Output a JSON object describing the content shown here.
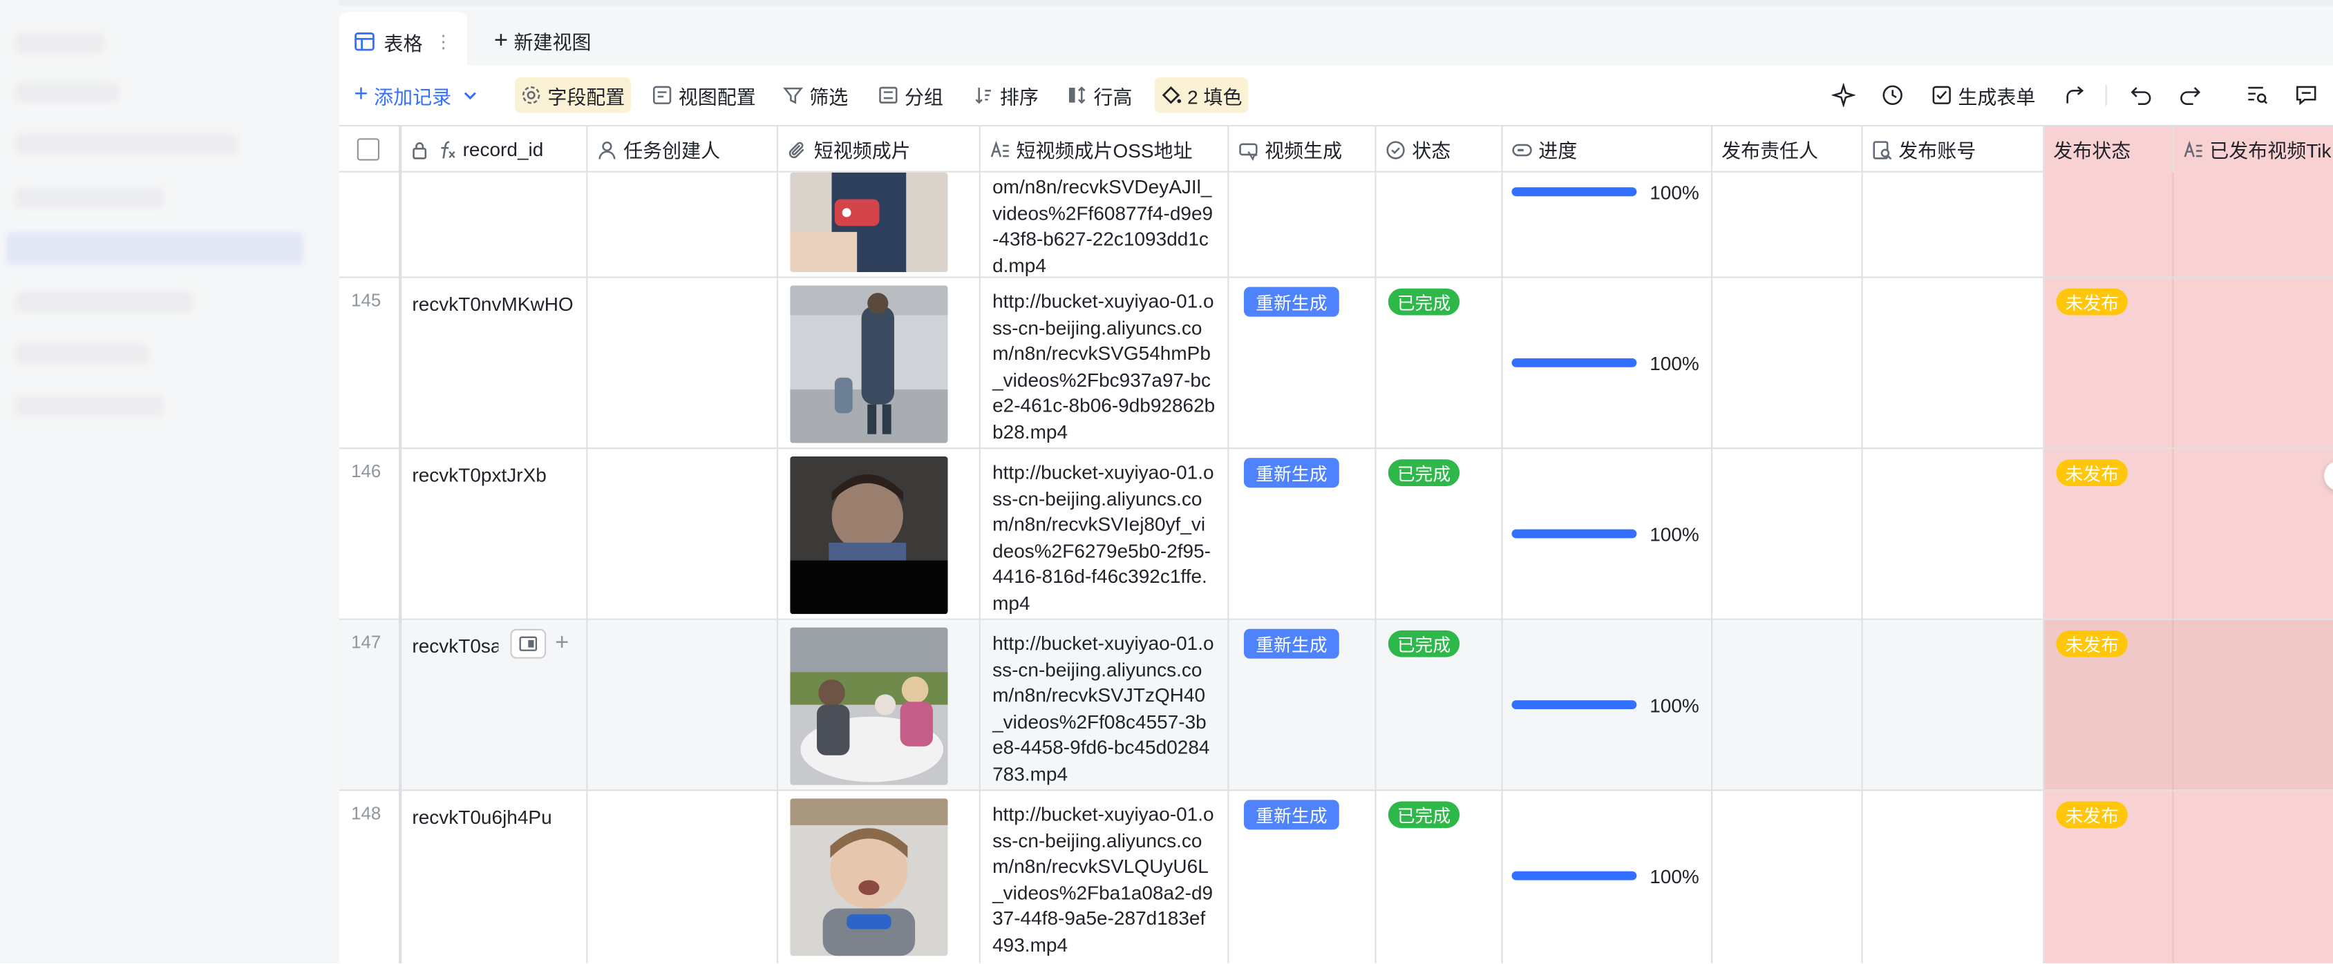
{
  "tabs": {
    "active_label": "表格",
    "new_view_label": "新建视图"
  },
  "toolbar": {
    "add_record": "添加记录",
    "field_config": "字段配置",
    "view_config": "视图配置",
    "filter": "筛选",
    "group": "分组",
    "sort": "排序",
    "row_height": "行高",
    "fill_color": "2 填色",
    "generate_form": "生成表单"
  },
  "columns": [
    {
      "label": "record_id",
      "icon": "formula-icon"
    },
    {
      "label": "任务创建人",
      "icon": "person-icon"
    },
    {
      "label": "短视频成片",
      "icon": "attachment-icon"
    },
    {
      "label": "短视频成片OSS地址",
      "icon": "text-icon"
    },
    {
      "label": "视频生成",
      "icon": "button-icon"
    },
    {
      "label": "状态",
      "icon": "status-icon"
    },
    {
      "label": "进度",
      "icon": "progress-icon"
    },
    {
      "label": "发布责任人",
      "icon": ""
    },
    {
      "label": "发布账号",
      "icon": "lookup-icon"
    },
    {
      "label": "发布状态",
      "icon": ""
    },
    {
      "label": "已发布视频Tik",
      "icon": "text-icon"
    }
  ],
  "partial_row": {
    "url": "om/n8n/recvkSVDeyAJIl_videos%2Ff60877f4-d9e9-43f8-b627-22c1093dd1cd.mp4",
    "progress_text": "100%",
    "progress": 1.0
  },
  "rows": [
    {
      "num": "145",
      "record_id": "recvkT0nvMKwHO",
      "url": "http://bucket-xuyiyao-01.oss-cn-beijing.aliyuncs.com/n8n/recvkSVG54hmPb_videos%2Fbc937a97-bce2-461c-8b06-9db92862bb28.mp4",
      "button": "重新生成",
      "status": "已完成",
      "progress_text": "100%",
      "progress": 1.0,
      "publish_status": "未发布"
    },
    {
      "num": "146",
      "record_id": "recvkT0pxtJrXb",
      "url": "http://bucket-xuyiyao-01.oss-cn-beijing.aliyuncs.com/n8n/recvkSVIej80yf_videos%2F6279e5b0-2f95-4416-816d-f46c392c1ffe.mp4",
      "button": "重新生成",
      "status": "已完成",
      "progress_text": "100%",
      "progress": 1.0,
      "publish_status": "未发布"
    },
    {
      "num": "147",
      "record_id": "recvkT0sa",
      "url": "http://bucket-xuyiyao-01.oss-cn-beijing.aliyuncs.com/n8n/recvkSVJTzQH40_videos%2Ff08c4557-3be8-4458-9fd6-bc45d0284783.mp4",
      "button": "重新生成",
      "status": "已完成",
      "progress_text": "100%",
      "progress": 1.0,
      "publish_status": "未发布"
    },
    {
      "num": "148",
      "record_id": "recvkT0u6jh4Pu",
      "url": "http://bucket-xuyiyao-01.oss-cn-beijing.aliyuncs.com/n8n/recvkSVLQUyU6L_videos%2Fba1a08a2-d937-44f8-9a5e-287d183ef493.mp4",
      "button": "重新生成",
      "status": "已完成",
      "progress_text": "100%",
      "progress": 1.0,
      "publish_status": "未发布"
    }
  ],
  "colors": {
    "accent": "#3370ff",
    "done_tag": "#2fb84a",
    "unpublished_tag": "#ffc60a",
    "publish_column_bg": "#f8d2d2"
  }
}
